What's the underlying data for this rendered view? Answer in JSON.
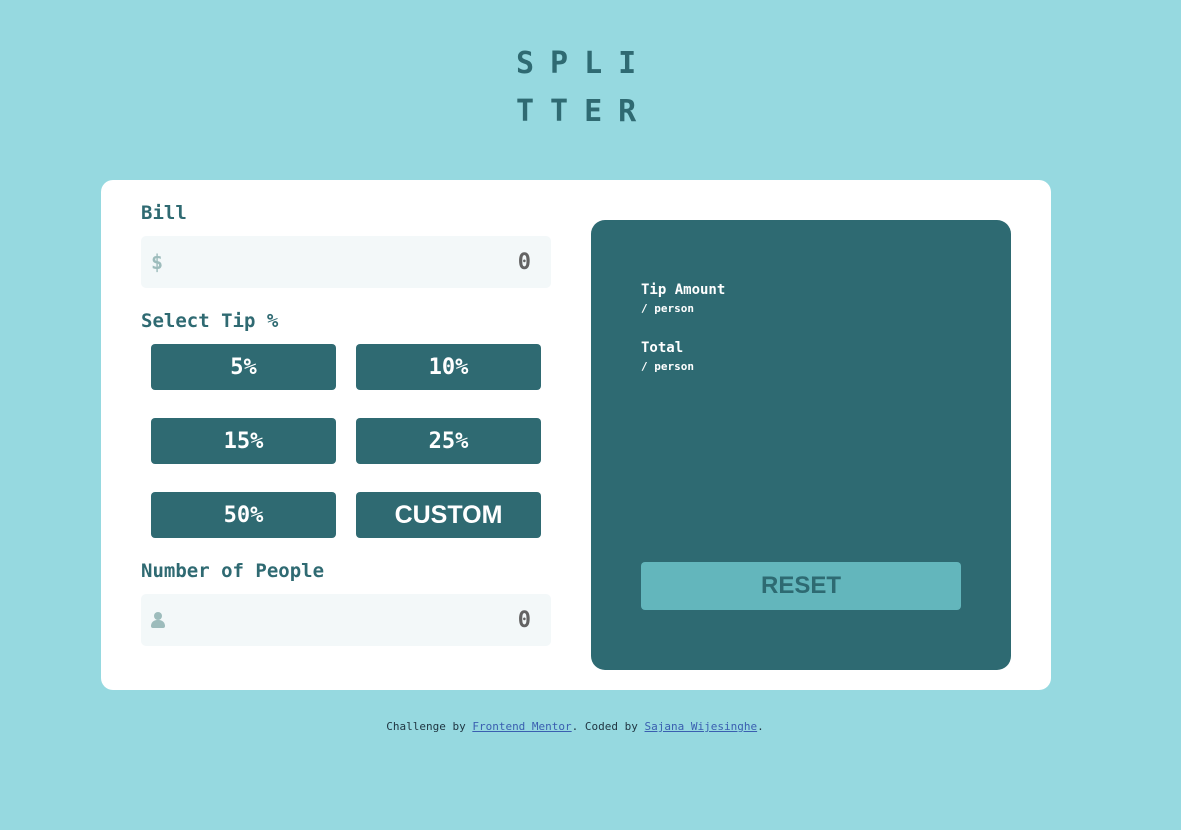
{
  "logo": {
    "line1": "SPLI",
    "line2": "TTER"
  },
  "bill": {
    "label": "Bill",
    "prefix": "$",
    "placeholder": "0"
  },
  "tip": {
    "label": "Select Tip %",
    "options": [
      "5%",
      "10%",
      "15%",
      "25%",
      "50%",
      "CUSTOM"
    ]
  },
  "people": {
    "label": "Number of People",
    "placeholder": "0",
    "icon": "person-icon"
  },
  "results": {
    "tip_title": "Tip Amount",
    "tip_sub": "/ person",
    "total_title": "Total",
    "total_sub": "/ person",
    "reset_label": "RESET"
  },
  "footer": {
    "prefix": "Challenge by ",
    "link1": "Frontend Mentor",
    "middle": ". Coded by ",
    "link2": "Sajana Wijesinghe",
    "suffix": "."
  },
  "colors": {
    "background": "#96d9e0",
    "primary": "#2f6a72",
    "reset_bg": "#63b6bc",
    "field_bg": "#f3f8f9"
  }
}
